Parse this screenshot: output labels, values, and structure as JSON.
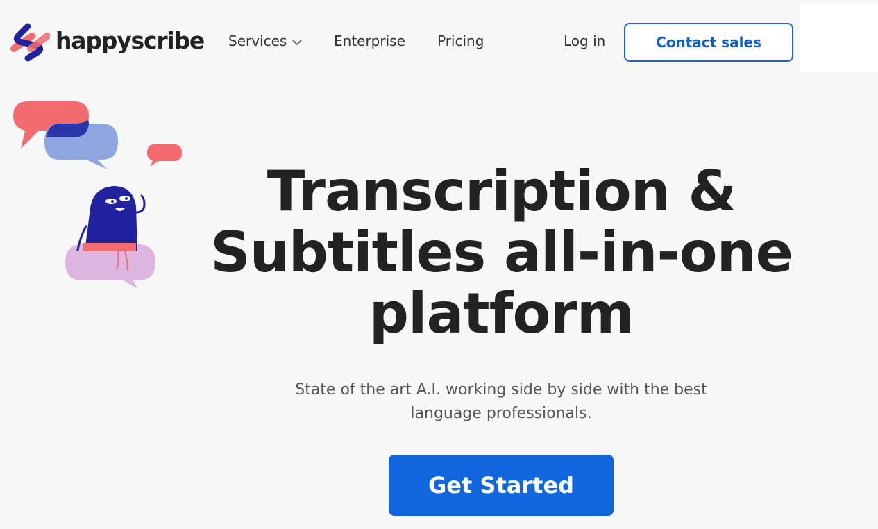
{
  "header": {
    "logo_text": "happyscribe",
    "nav": {
      "services": "Services",
      "enterprise": "Enterprise",
      "pricing": "Pricing"
    },
    "login": "Log in",
    "contact_sales": "Contact sales"
  },
  "hero": {
    "title": "Transcription & Subtitles all-in-one platform",
    "subtitle": "State of the art A.I. working side by side with the best language professionals.",
    "cta": "Get Started"
  },
  "colors": {
    "background": "#f7f7f7",
    "brand_blue": "#0f66dd",
    "dark_navy": "#22229e",
    "coral": "#f26b6e",
    "periwinkle": "#8ea5e0",
    "lilac": "#dcb5e1"
  },
  "icons": {
    "logo": "happyscribe-logo-icon",
    "services_dropdown": "chevron-down-icon"
  }
}
